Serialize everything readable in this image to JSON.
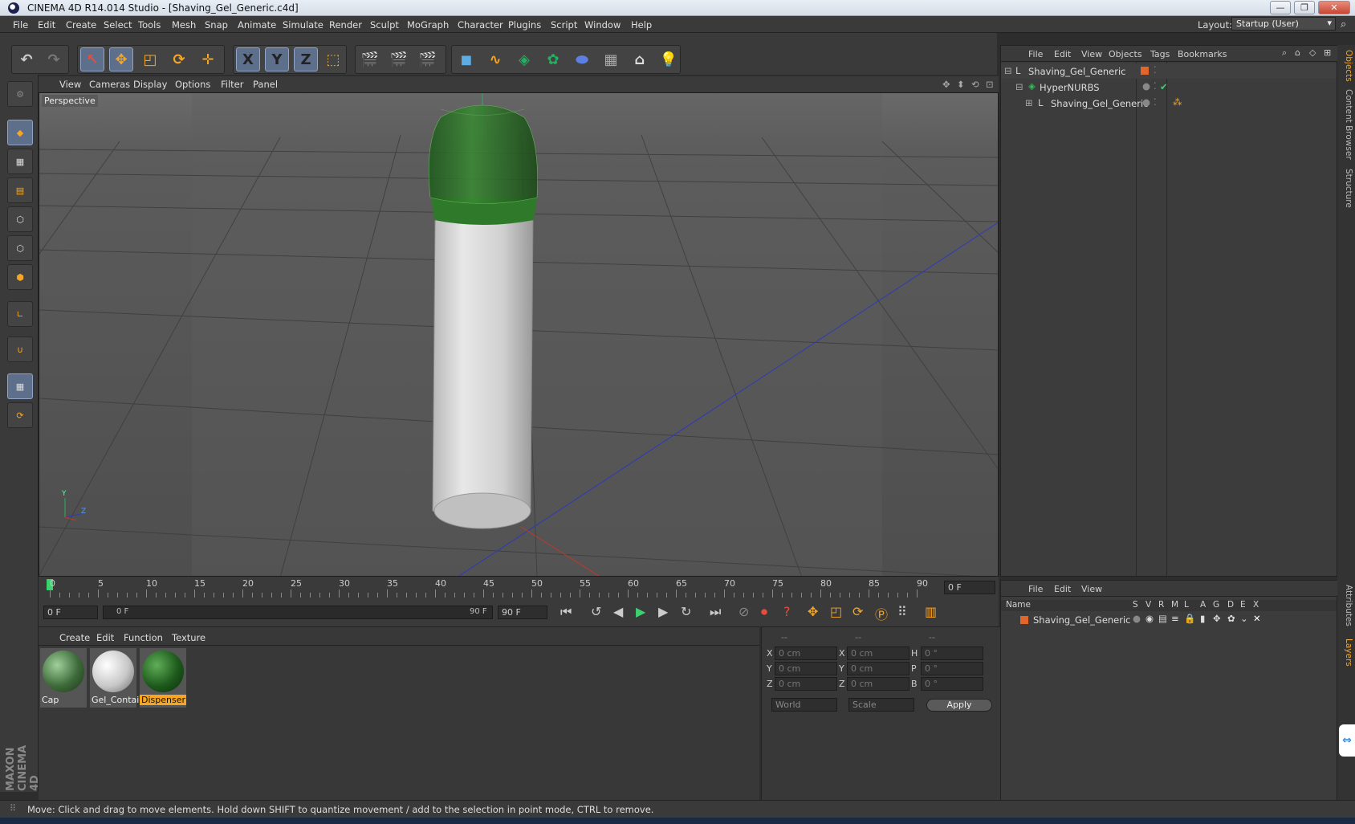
{
  "window": {
    "title": "CINEMA 4D R14.014 Studio - [Shaving_Gel_Generic.c4d]",
    "controls": {
      "minimize": "—",
      "restore": "❐",
      "close": "✕"
    }
  },
  "menubar": {
    "items": [
      "File",
      "Edit",
      "Create",
      "Select",
      "Tools",
      "Mesh",
      "Snap",
      "Animate",
      "Simulate",
      "Render",
      "Sculpt",
      "MoGraph",
      "Character",
      "Plugins",
      "Script",
      "Window",
      "Help"
    ],
    "layout_label": "Layout:",
    "layout_value": "Startup (User)"
  },
  "toolbar": {
    "axis_buttons": [
      "X",
      "Y",
      "Z"
    ]
  },
  "viewport": {
    "menu": [
      "View",
      "Cameras",
      "Display",
      "Options",
      "Filter",
      "Panel"
    ],
    "label": "Perspective",
    "axis_labels": {
      "y": "Y",
      "z": "Z"
    },
    "colors": {
      "cap_green": "#2f7a2a",
      "body_white": "#d6d6d6",
      "x_axis": "#c0392b",
      "y_axis": "#27ae60",
      "z_axis": "#2e3ab8"
    }
  },
  "timeline": {
    "ticks": [
      "0",
      "5",
      "10",
      "15",
      "20",
      "25",
      "30",
      "35",
      "40",
      "45",
      "50",
      "55",
      "60",
      "65",
      "70",
      "75",
      "80",
      "85",
      "90"
    ],
    "current_frame": "0 F"
  },
  "transport": {
    "start_field": "0 F",
    "range_start": "0 F",
    "range_end": "90 F",
    "end_field": "90 F"
  },
  "materials": {
    "menu": [
      "Create",
      "Edit",
      "Function",
      "Texture"
    ],
    "items": [
      {
        "label": "Cap",
        "color": "#3e6a3a"
      },
      {
        "label": "Gel_Contai",
        "color": "#c8c8c8"
      },
      {
        "label": "Dispenser",
        "color": "#1e5a1c"
      }
    ]
  },
  "coordinates": {
    "headers": [
      "--",
      "--",
      "--"
    ],
    "rows": [
      {
        "a": "X",
        "a_val": "0 cm",
        "b": "X",
        "b_val": "0 cm",
        "c": "H",
        "c_val": "0 °"
      },
      {
        "a": "Y",
        "a_val": "0 cm",
        "b": "Y",
        "b_val": "0 cm",
        "c": "P",
        "c_val": "0 °"
      },
      {
        "a": "Z",
        "a_val": "0 cm",
        "b": "Z",
        "b_val": "0 cm",
        "c": "B",
        "c_val": "0 °"
      }
    ],
    "space": "World",
    "mode": "Scale",
    "apply": "Apply"
  },
  "object_manager": {
    "menu": [
      "File",
      "Edit",
      "View",
      "Objects",
      "Tags",
      "Bookmarks"
    ],
    "tree": [
      {
        "name": "Shaving_Gel_Generic",
        "level": 0,
        "check": ""
      },
      {
        "name": "HyperNURBS",
        "level": 1,
        "check": "✔"
      },
      {
        "name": "Shaving_Gel_Generic",
        "level": 2,
        "check": ""
      }
    ]
  },
  "layer_manager": {
    "menu": [
      "File",
      "Edit",
      "View"
    ],
    "columns": [
      "Name",
      "S",
      "V",
      "R",
      "M",
      "L",
      "A",
      "G",
      "D",
      "E",
      "X"
    ],
    "rows": [
      {
        "name": "Shaving_Gel_Generic",
        "color": "#e0662a"
      }
    ]
  },
  "side_tabs": [
    "Objects",
    "Content Browser",
    "Structure",
    "Attributes",
    "Layers"
  ],
  "brand": {
    "maxon": "MAXON",
    "cinema": "CINEMA 4D"
  },
  "status": "Move: Click and drag to move elements. Hold down SHIFT to quantize movement / add to the selection in point mode, CTRL to remove."
}
